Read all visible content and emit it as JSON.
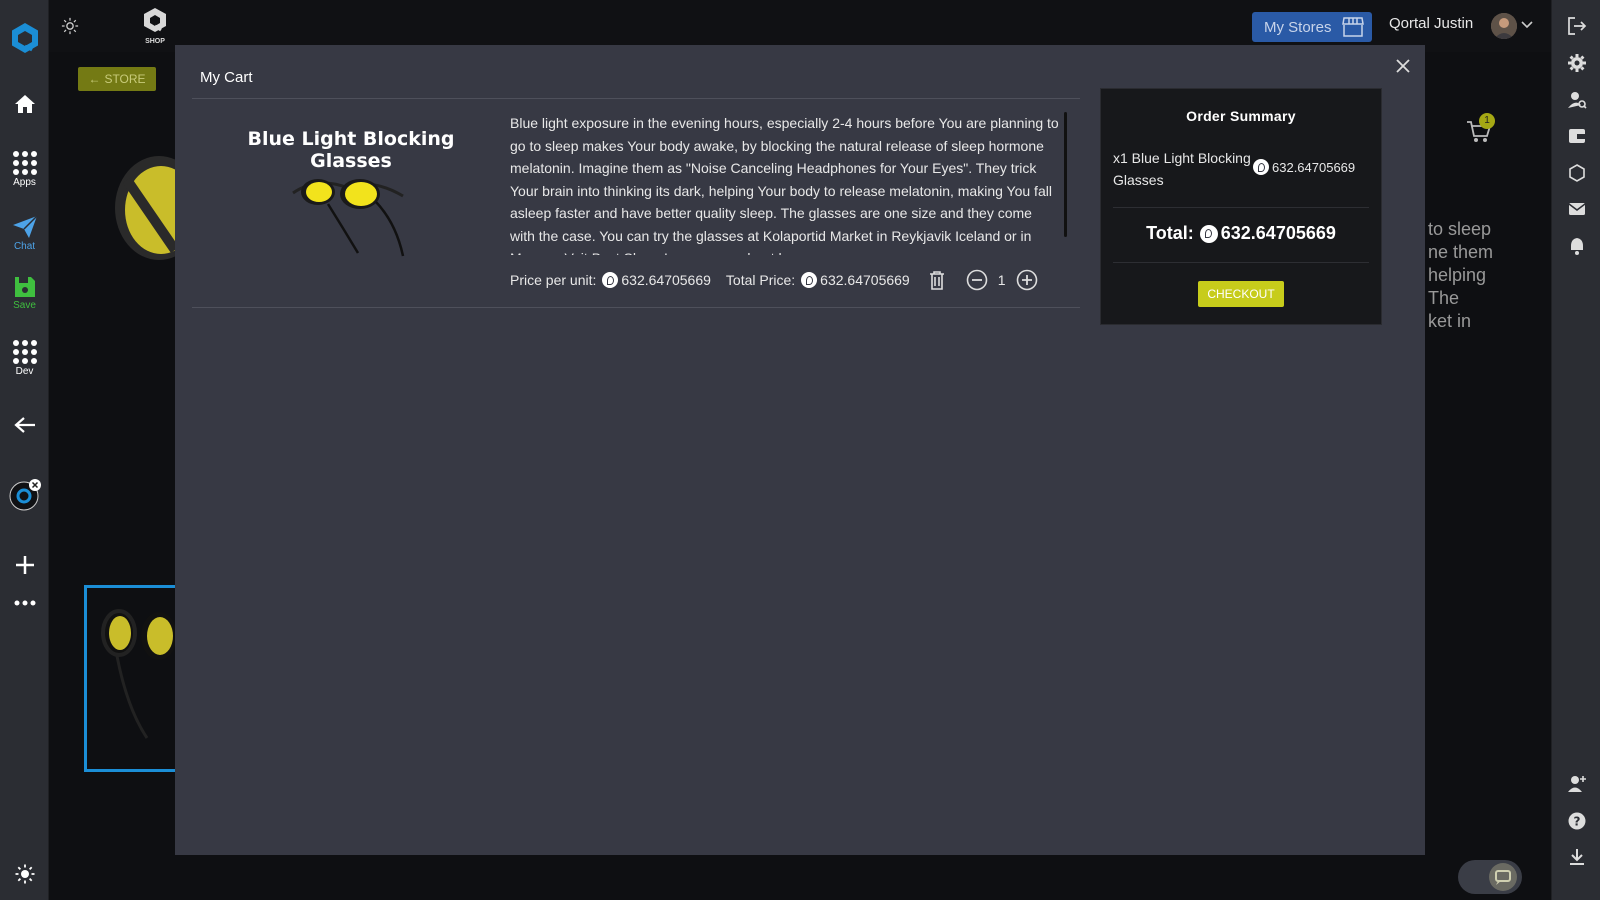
{
  "left_bar": {
    "items": [
      {
        "id": "home",
        "label": ""
      },
      {
        "id": "apps",
        "label": "Apps"
      },
      {
        "id": "chat",
        "label": "Chat"
      },
      {
        "id": "save",
        "label": "Save"
      },
      {
        "id": "dev",
        "label": "Dev"
      }
    ]
  },
  "top_bar": {
    "brand_label": "SHOP",
    "my_stores_label": "My Stores",
    "user_name": "Qortal Justin"
  },
  "background": {
    "store_back_label": "STORE",
    "desc_fragment": "to sleep\nne them\nhelping\nThe\nket in",
    "cart_count": "1"
  },
  "modal": {
    "title": "My Cart",
    "item": {
      "name": "Blue Light Blocking Glasses",
      "description": "Blue light exposure in the evening hours, especially 2-4 hours before You are planning to go to sleep makes Your body awake, by blocking the natural release of sleep hormone melatonin. Imagine them as \"Noise Canceling Headphones for Your Eyes\". They trick Your brain into thinking its dark, helping Your body to release melatonin, making You fall asleep faster and have better quality sleep. The glasses are one size and they come with the case. You can try the glasses at Kolaportid Market in Reykjavik Iceland or in Mamma Veit Best Shop. Learn more about how",
      "price_per_unit_label": "Price per unit:",
      "price_per_unit": "632.64705669",
      "total_price_label": "Total Price:",
      "total_price": "632.64705669",
      "quantity": "1"
    },
    "summary": {
      "title": "Order Summary",
      "line_item": "x1 Blue Light Blocking Glasses",
      "line_price": "632.64705669",
      "total_label": "Total:",
      "total_value": "632.64705669",
      "checkout_label": "CHECKOUT"
    }
  },
  "colors": {
    "accent_yellow": "#c7cc1b",
    "my_stores_blue": "#2a5aa6",
    "modal_bg": "#373944",
    "summary_bg": "#17181b"
  }
}
